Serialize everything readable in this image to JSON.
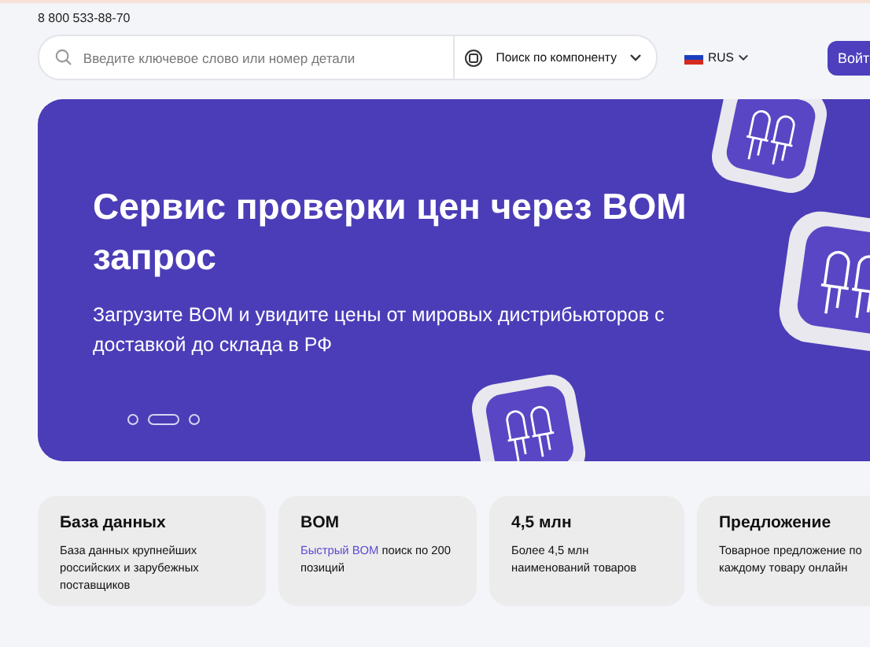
{
  "header": {
    "phone": "8 800 533-88-70",
    "search": {
      "placeholder": "Введите ключевое слово или номер детали"
    },
    "mode_select": {
      "value": "Поиск по компоненту"
    },
    "language": {
      "value": "RUS"
    },
    "login_button": "Войт"
  },
  "banner": {
    "title": "Сервис проверки цен через BOM запрос",
    "subtitle": "Загрузите BOM и увидите цены от мировых дистрибьюторов с доставкой до склада в РФ",
    "slides": [
      {
        "selected": false
      },
      {
        "selected": true
      },
      {
        "selected": false
      }
    ]
  },
  "features": [
    {
      "title": "База данных",
      "text": "База данных крупнейших российских и зарубежных поставщиков"
    },
    {
      "title": "BOM",
      "link": "Быстрый BOM",
      "text": "поиск по 200 позиций"
    },
    {
      "title": "4,5 млн",
      "text": "Более 4,5 млн наименований товаров"
    },
    {
      "title": "Предложение",
      "text": "Товарное предложение по каждому товару онлайн"
    }
  ]
}
